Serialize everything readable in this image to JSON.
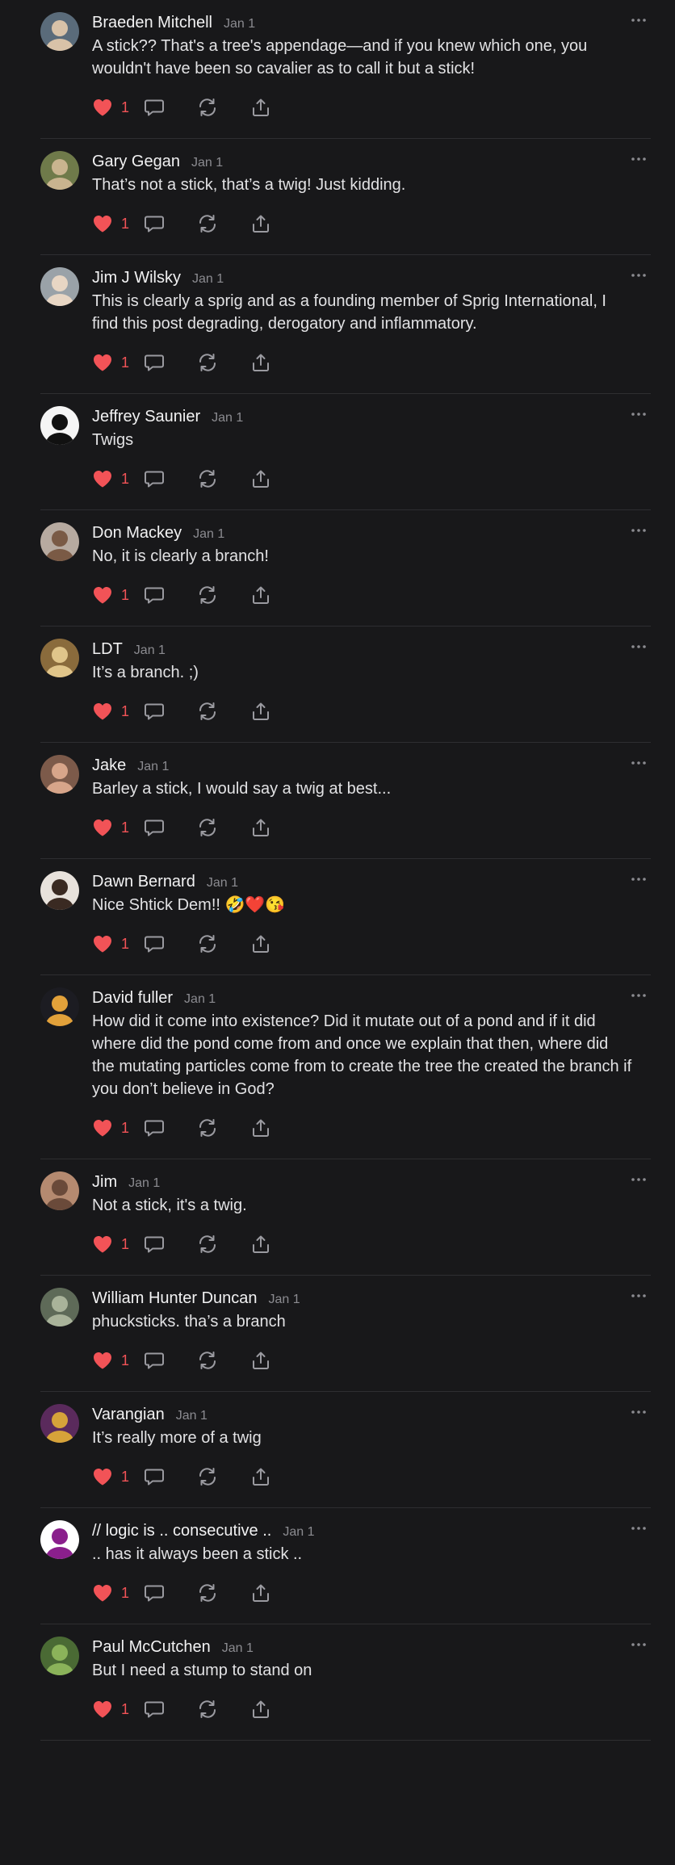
{
  "comments": [
    {
      "name": "Braeden Mitchell",
      "date": "Jan 1",
      "text": "A stick?? That's a tree's appendage—and if you knew which one, you wouldn't have been so cavalier as to call it but a stick!",
      "likes": "1",
      "avatar": {
        "bg": "#5a6b7a",
        "fg": "#d8c2a8"
      }
    },
    {
      "name": "Gary Gegan",
      "date": "Jan 1",
      "text": "That’s not a stick, that’s a twig! Just kidding.",
      "likes": "1",
      "avatar": {
        "bg": "#6f7a4a",
        "fg": "#c9b48f"
      }
    },
    {
      "name": "Jim J Wilsky",
      "date": "Jan 1",
      "text": "This is clearly a sprig and as a founding member of Sprig International, I find this post degrading, derogatory and inflammatory.",
      "likes": "1",
      "avatar": {
        "bg": "#9aa2a8",
        "fg": "#e8d6c4"
      }
    },
    {
      "name": "Jeffrey Saunier",
      "date": "Jan 1",
      "text": "Twigs",
      "likes": "1",
      "avatar": {
        "bg": "#f5f5f5",
        "fg": "#111111"
      }
    },
    {
      "name": "Don Mackey",
      "date": "Jan 1",
      "text": "No, it is clearly a branch!",
      "likes": "1",
      "avatar": {
        "bg": "#b7aaa0",
        "fg": "#7a5a45"
      }
    },
    {
      "name": "LDT",
      "date": "Jan 1",
      "text": "It’s a branch. ;)",
      "likes": "1",
      "avatar": {
        "bg": "#8a6b3c",
        "fg": "#e0c58a"
      }
    },
    {
      "name": "Jake",
      "date": "Jan 1",
      "text": "Barley a stick, I would say a twig at best...",
      "likes": "1",
      "avatar": {
        "bg": "#7c5a4a",
        "fg": "#d7a58a"
      }
    },
    {
      "name": "Dawn Bernard",
      "date": "Jan 1",
      "text": "Nice Shtick Dem!! 🤣❤️😘",
      "likes": "1",
      "avatar": {
        "bg": "#e8e2dc",
        "fg": "#3a2a22"
      }
    },
    {
      "name": "David fuller",
      "date": "Jan 1",
      "text": "How did it come into existence? Did it mutate out of a pond and if it did where did the pond come from and once we explain that then, where did the mutating particles come from to create the tree the created the branch if you don’t believe in God?",
      "likes": "1",
      "avatar": {
        "bg": "#1c1c22",
        "fg": "#e2a13a"
      }
    },
    {
      "name": "Jim",
      "date": "Jan 1",
      "text": "Not a stick, it's a twig.",
      "likes": "1",
      "avatar": {
        "bg": "#b58a70",
        "fg": "#6a4a3a"
      }
    },
    {
      "name": "William Hunter Duncan",
      "date": "Jan 1",
      "text": "phucksticks. tha’s a branch",
      "likes": "1",
      "avatar": {
        "bg": "#5e6a58",
        "fg": "#a9b39a"
      }
    },
    {
      "name": "Varangian",
      "date": "Jan 1",
      "text": "It’s really more of a twig",
      "likes": "1",
      "avatar": {
        "bg": "#5a2a5c",
        "fg": "#d6a33a"
      }
    },
    {
      "name": "// logic is .. consecutive ..",
      "date": "Jan 1",
      "text": ".. has it always been a stick ..",
      "likes": "1",
      "avatar": {
        "bg": "#ffffff",
        "fg": "#8a1f8c"
      }
    },
    {
      "name": "Paul McCutchen",
      "date": "Jan 1",
      "text": "But I need a stump to stand on",
      "likes": "1",
      "avatar": {
        "bg": "#4a6a34",
        "fg": "#8bb35a"
      }
    }
  ],
  "icons": {
    "like": "heart-icon",
    "reply": "comment-bubble-icon",
    "repost": "repost-icon",
    "share": "share-icon",
    "more": "more-dots-icon"
  },
  "colors": {
    "background": "#18181a",
    "like": "#f25357",
    "muted": "#8b8b90"
  }
}
